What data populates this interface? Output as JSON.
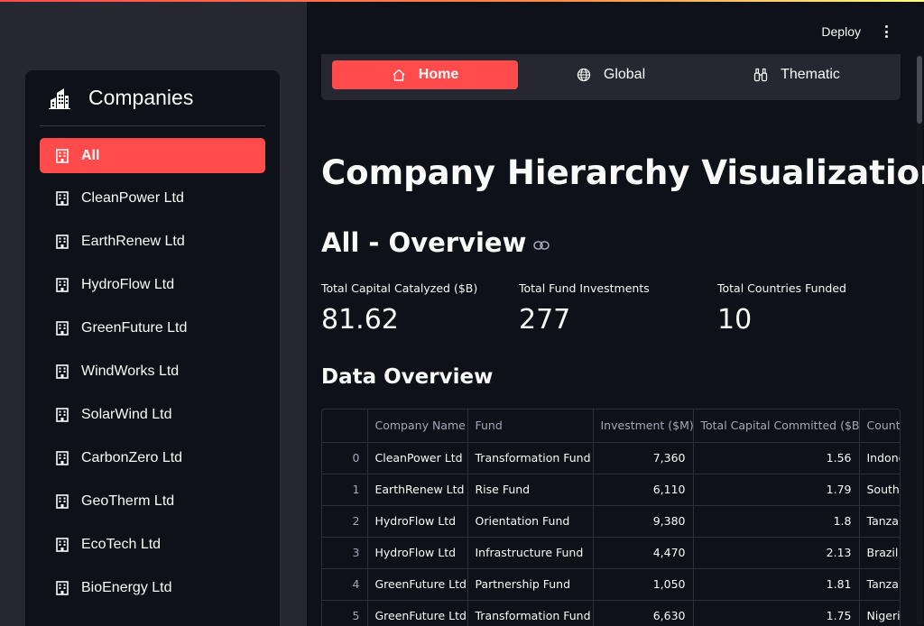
{
  "header": {
    "deploy_label": "Deploy"
  },
  "sidebar": {
    "title": "Companies",
    "items": [
      {
        "label": "All",
        "active": true
      },
      {
        "label": "CleanPower Ltd"
      },
      {
        "label": "EarthRenew Ltd"
      },
      {
        "label": "HydroFlow Ltd"
      },
      {
        "label": "GreenFuture Ltd"
      },
      {
        "label": "WindWorks Ltd"
      },
      {
        "label": "SolarWind Ltd"
      },
      {
        "label": "CarbonZero Ltd"
      },
      {
        "label": "GeoTherm Ltd"
      },
      {
        "label": "EcoTech Ltd"
      },
      {
        "label": "BioEnergy Ltd"
      }
    ]
  },
  "nav": {
    "tabs": [
      {
        "label": "Home",
        "icon": "house-icon",
        "active": true
      },
      {
        "label": "Global",
        "icon": "globe-icon"
      },
      {
        "label": "Thematic",
        "icon": "binoculars-icon"
      }
    ]
  },
  "main": {
    "title": "Company Hierarchy Visualization",
    "subheader": "All - Overview",
    "metrics": [
      {
        "label": "Total Capital Catalyzed ($B)",
        "value": "81.62"
      },
      {
        "label": "Total Fund Investments",
        "value": "277"
      },
      {
        "label": "Total Countries Funded",
        "value": "10"
      }
    ],
    "section_title": "Data Overview"
  },
  "table": {
    "columns": [
      "",
      "Company Name",
      "Fund",
      "Investment ($M)",
      "Total Capital Committed ($B)",
      "Country"
    ],
    "rows": [
      [
        "0",
        "CleanPower Ltd",
        "Transformation Fund",
        "7,360",
        "1.56",
        "Indonesia"
      ],
      [
        "1",
        "EarthRenew Ltd",
        "Rise Fund",
        "6,110",
        "1.79",
        "South Africa"
      ],
      [
        "2",
        "HydroFlow Ltd",
        "Orientation Fund",
        "9,380",
        "1.8",
        "Tanzania"
      ],
      [
        "3",
        "HydroFlow Ltd",
        "Infrastructure Fund",
        "4,470",
        "2.13",
        "Brazil"
      ],
      [
        "4",
        "GreenFuture Ltd",
        "Partnership Fund",
        "1,050",
        "1.81",
        "Tanzania"
      ],
      [
        "5",
        "GreenFuture Ltd",
        "Transformation Fund",
        "6,630",
        "1.75",
        "Nigeria"
      ]
    ]
  },
  "colors": {
    "accent": "#ff4b4b",
    "background": "#0e1117",
    "sidebar": "#262730"
  }
}
